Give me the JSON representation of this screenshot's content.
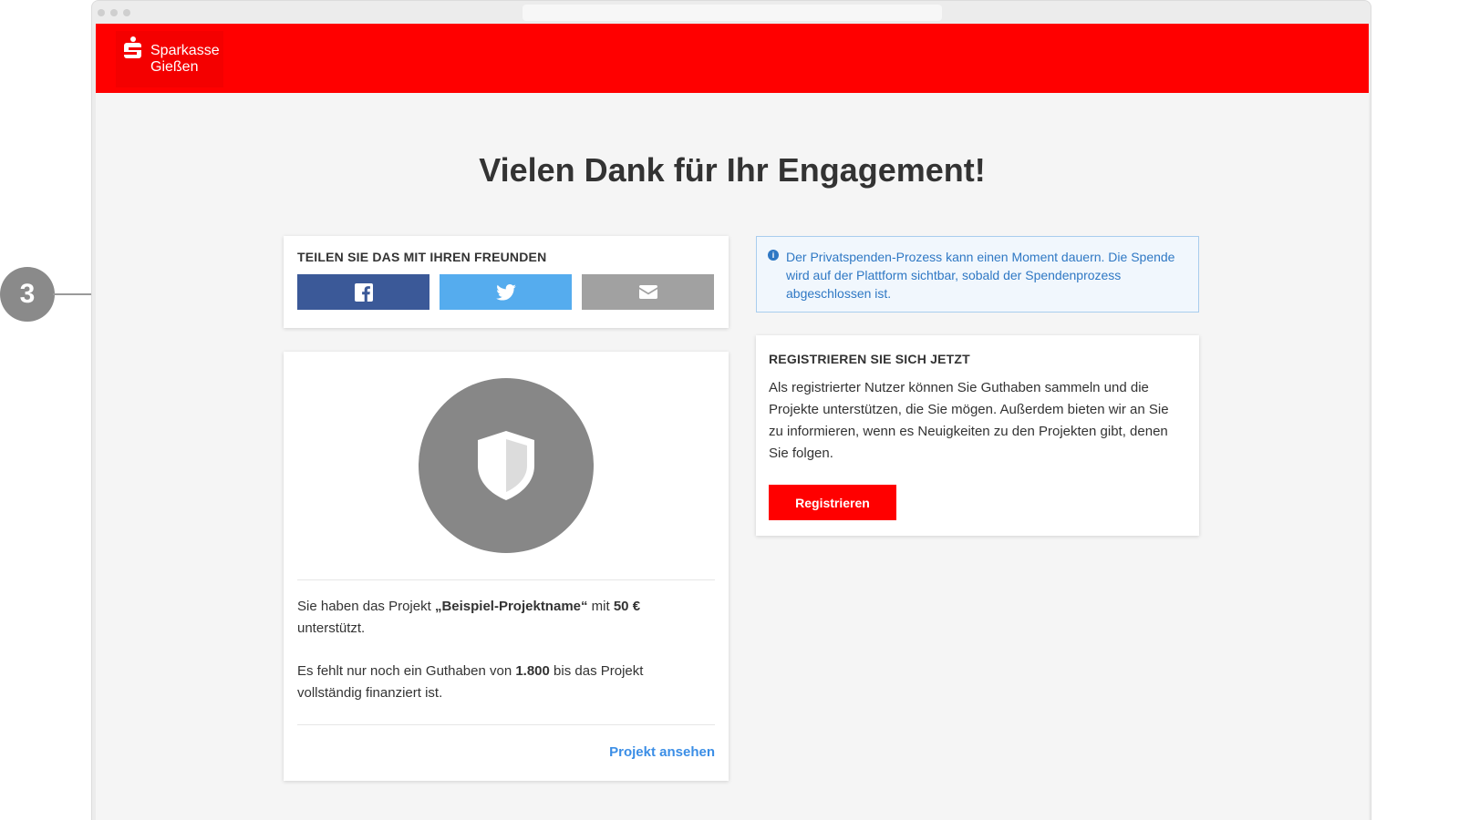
{
  "brand": {
    "name_line1": "Sparkasse",
    "name_line2": "Gießen",
    "header_color": "#ff0000"
  },
  "page": {
    "title": "Vielen Dank für Ihr Engagement!"
  },
  "share": {
    "heading": "TEILEN SIE DAS MIT IHREN FREUNDEN",
    "buttons": [
      {
        "icon": "facebook-icon",
        "color": "#3b5998"
      },
      {
        "icon": "twitter-icon",
        "color": "#55acee"
      },
      {
        "icon": "mail-icon",
        "color": "#a1a1a1"
      }
    ]
  },
  "project": {
    "icon": "shield-icon",
    "text1_pre": "Sie haben das Projekt ",
    "project_name": "„Beispiel-Projektname“",
    "text1_mid": " mit ",
    "amount": "50 €",
    "text1_post": "unterstützt.",
    "text2_pre": "Es fehlt nur noch ein Guthaben von ",
    "remaining": "1.800",
    "text2_post": " bis das Projekt vollständig finanziert ist.",
    "link_label": "Projekt ansehen"
  },
  "info": {
    "icon": "info-icon",
    "text": "Der Privatspenden-Prozess kann einen Moment dauern. Die Spende wird auf der Plattform sichtbar, sobald der Spendenprozess abgeschlossen ist."
  },
  "register": {
    "heading": "REGISTRIEREN SIE SICH JETZT",
    "text": "Als registrierter Nutzer können Sie Guthaben sammeln und die Projekte unterstützen, die Sie mögen. Außerdem bieten wir an Sie zu informieren, wenn es Neuigkeiten zu den Projekten gibt, denen Sie folgen.",
    "button_label": "Registrieren"
  },
  "annotation": {
    "number": "3"
  }
}
